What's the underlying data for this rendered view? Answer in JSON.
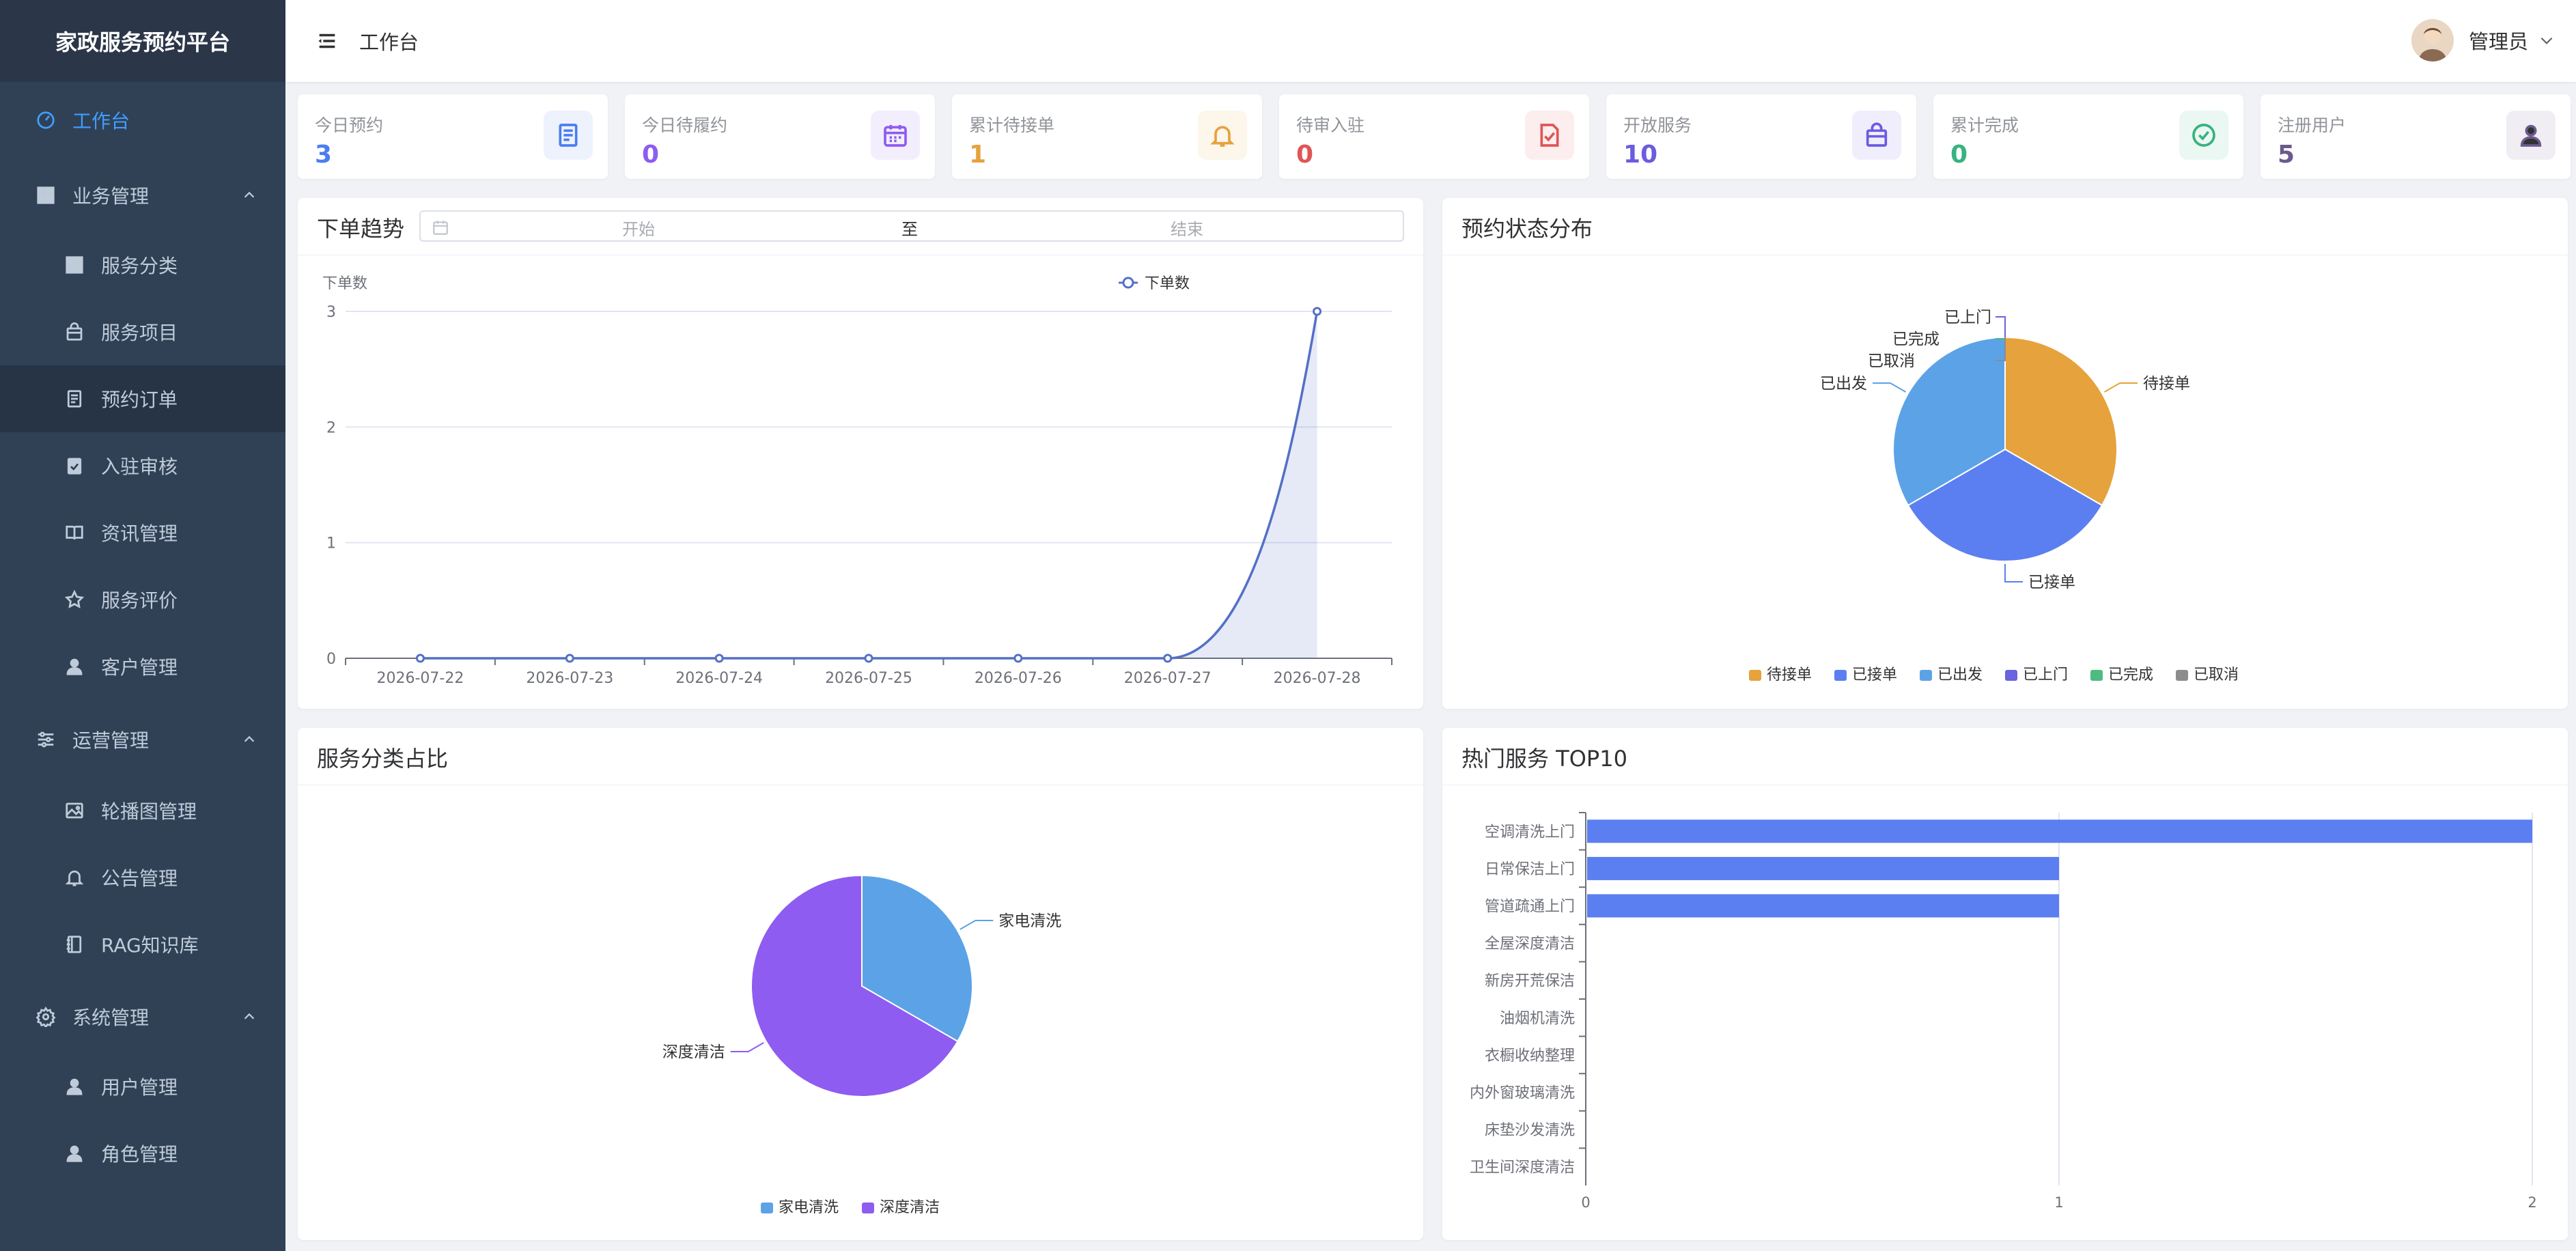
{
  "app": {
    "title": "家政服务预约平台"
  },
  "sidebar": {
    "items": [
      {
        "label": "工作台",
        "icon": "dashboard-icon"
      },
      {
        "label": "业务管理",
        "icon": "grid-icon"
      },
      {
        "label": "服务分类",
        "icon": "category-icon"
      },
      {
        "label": "服务项目",
        "icon": "bag-icon"
      },
      {
        "label": "预约订单",
        "icon": "document-icon"
      },
      {
        "label": "入驻审核",
        "icon": "clipboard-icon"
      },
      {
        "label": "资讯管理",
        "icon": "book-icon"
      },
      {
        "label": "服务评价",
        "icon": "star-icon"
      },
      {
        "label": "客户管理",
        "icon": "user-icon"
      },
      {
        "label": "运营管理",
        "icon": "sliders-icon"
      },
      {
        "label": "轮播图管理",
        "icon": "image-icon"
      },
      {
        "label": "公告管理",
        "icon": "bell-icon"
      },
      {
        "label": "RAG知识库",
        "icon": "notebook-icon"
      },
      {
        "label": "系统管理",
        "icon": "gear-icon"
      },
      {
        "label": "用户管理",
        "icon": "user-icon"
      },
      {
        "label": "角色管理",
        "icon": "user-role-icon"
      }
    ]
  },
  "header": {
    "breadcrumb": "工作台",
    "user": "管理员"
  },
  "stats": [
    {
      "label": "今日预约",
      "value": "3",
      "color": "#4a7ef0",
      "icon": "document-icon"
    },
    {
      "label": "今日待履约",
      "value": "0",
      "color": "#8e5cf0",
      "icon": "calendar-icon"
    },
    {
      "label": "累计待接单",
      "value": "1",
      "color": "#e6a23c",
      "icon": "bell-icon"
    },
    {
      "label": "待审入驻",
      "value": "0",
      "color": "#e05555",
      "icon": "file-check-icon"
    },
    {
      "label": "开放服务",
      "value": "10",
      "color": "#6b5ce0",
      "icon": "bag-icon"
    },
    {
      "label": "累计完成",
      "value": "0",
      "color": "#36b37e",
      "icon": "check-circle-icon"
    },
    {
      "label": "注册用户",
      "value": "5",
      "color": "#6b5a8e",
      "icon": "user-icon"
    }
  ],
  "trend": {
    "title": "下单趋势",
    "date_start": "开始",
    "date_sep": "至",
    "date_end": "结束"
  },
  "status": {
    "title": "预约状态分布"
  },
  "category": {
    "title": "服务分类占比"
  },
  "top10": {
    "title": "热门服务 TOP10"
  },
  "chart_data": [
    {
      "type": "line",
      "title": "下单趋势",
      "ylabel": "下单数",
      "x": [
        "2026-07-22",
        "2026-07-23",
        "2026-07-24",
        "2026-07-25",
        "2026-07-26",
        "2026-07-27",
        "2026-07-28"
      ],
      "series": [
        {
          "name": "下单数",
          "values": [
            0,
            0,
            0,
            0,
            0,
            0,
            3
          ]
        }
      ],
      "ylim": [
        0,
        3
      ],
      "yticks": [
        0,
        1,
        2,
        3
      ],
      "grid": true,
      "legend": "top-center",
      "color": "#5470c6",
      "area": true
    },
    {
      "type": "pie",
      "title": "预约状态分布",
      "labels": [
        "待接单",
        "已接单",
        "已出发",
        "已上门",
        "已完成",
        "已取消"
      ],
      "values": [
        1,
        1,
        1,
        0,
        0,
        0
      ],
      "colors": [
        "#e6a23c",
        "#5b7ff0",
        "#5ba3e6",
        "#6b62e0",
        "#4dbb82",
        "#8c8c8c"
      ],
      "legend": "bottom"
    },
    {
      "type": "pie",
      "title": "服务分类占比",
      "labels": [
        "家电清洗",
        "深度清洁"
      ],
      "values": [
        1,
        2
      ],
      "colors": [
        "#5ba3e6",
        "#8e5cf0"
      ],
      "legend": "bottom"
    },
    {
      "type": "bar",
      "orientation": "horizontal",
      "title": "热门服务 TOP10",
      "categories": [
        "空调清洗上门",
        "日常保洁上门",
        "管道疏通上门",
        "全屋深度清洁",
        "新房开荒保洁",
        "油烟机清洗",
        "衣橱收纳整理",
        "内外窗玻璃清洗",
        "床垫沙发清洗",
        "卫生间深度清洁"
      ],
      "values": [
        2,
        1,
        1,
        0,
        0,
        0,
        0,
        0,
        0,
        0
      ],
      "xlim": [
        0,
        2
      ],
      "xticks": [
        0,
        1,
        2
      ],
      "color": "#5b7ff0"
    }
  ]
}
